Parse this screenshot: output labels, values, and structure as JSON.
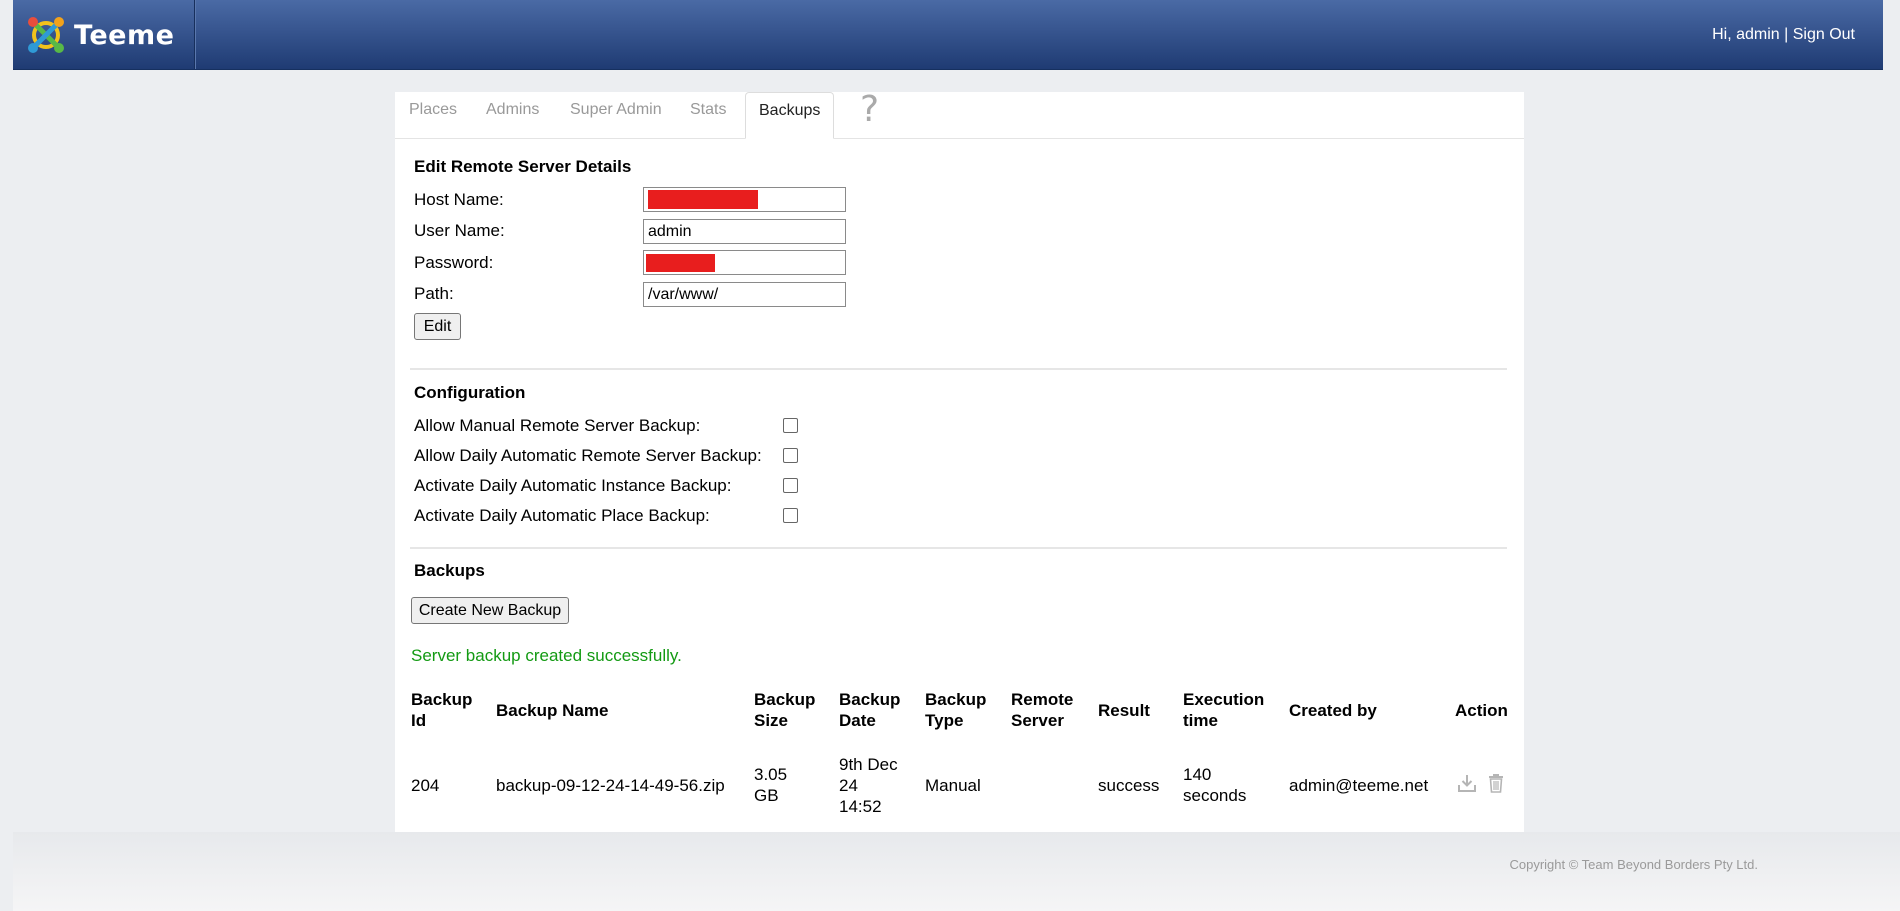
{
  "header": {
    "brand": "Teeme",
    "greeting": "Hi, admin",
    "separator": "|",
    "signout": "Sign Out"
  },
  "tabs": [
    {
      "label": "Places",
      "active": false
    },
    {
      "label": "Admins",
      "active": false
    },
    {
      "label": "Super Admin",
      "active": false
    },
    {
      "label": "Stats",
      "active": false
    },
    {
      "label": "Backups",
      "active": true
    }
  ],
  "help_icon": "?",
  "remote": {
    "title": "Edit Remote Server Details",
    "host_label": "Host Name:",
    "host_value": "",
    "user_label": "User Name:",
    "user_value": "admin",
    "password_label": "Password:",
    "password_value": "",
    "path_label": "Path:",
    "path_value": "/var/www/",
    "edit_button": "Edit"
  },
  "config": {
    "title": "Configuration",
    "items": [
      {
        "label": "Allow Manual Remote Server Backup:",
        "checked": false
      },
      {
        "label": "Allow Daily Automatic Remote Server Backup:",
        "checked": false
      },
      {
        "label": "Activate Daily Automatic Instance Backup:",
        "checked": false
      },
      {
        "label": "Activate Daily Automatic Place Backup:",
        "checked": false
      }
    ]
  },
  "backups": {
    "title": "Backups",
    "create_button": "Create New Backup",
    "message": "Server backup created successfully.",
    "columns": [
      [
        "Backup",
        "Id"
      ],
      [
        "Backup Name"
      ],
      [
        "Backup",
        "Size"
      ],
      [
        "Backup",
        "Date"
      ],
      [
        "Backup",
        "Type"
      ],
      [
        "Remote",
        "Server"
      ],
      [
        "Result"
      ],
      [
        "Execution",
        "time"
      ],
      [
        "Created by"
      ],
      [
        "Action"
      ]
    ],
    "rows": [
      {
        "id": "204",
        "name": "backup-09-12-24-14-49-56.zip",
        "size": [
          "3.05",
          "GB"
        ],
        "date": [
          "9th Dec",
          "24",
          "14:52"
        ],
        "type": "Manual",
        "remote": "",
        "result": "success",
        "exec": [
          "140",
          "seconds"
        ],
        "created_by": "admin@teeme.net",
        "actions": [
          "download-icon",
          "trash-icon"
        ]
      }
    ]
  },
  "footer": {
    "copyright": "Copyright © Team Beyond Borders Pty Ltd."
  },
  "colors": {
    "header_top": "#4a6aa5",
    "header_bottom": "#1f3b73",
    "success": "#139a13",
    "redaction": "#e81e1e"
  }
}
